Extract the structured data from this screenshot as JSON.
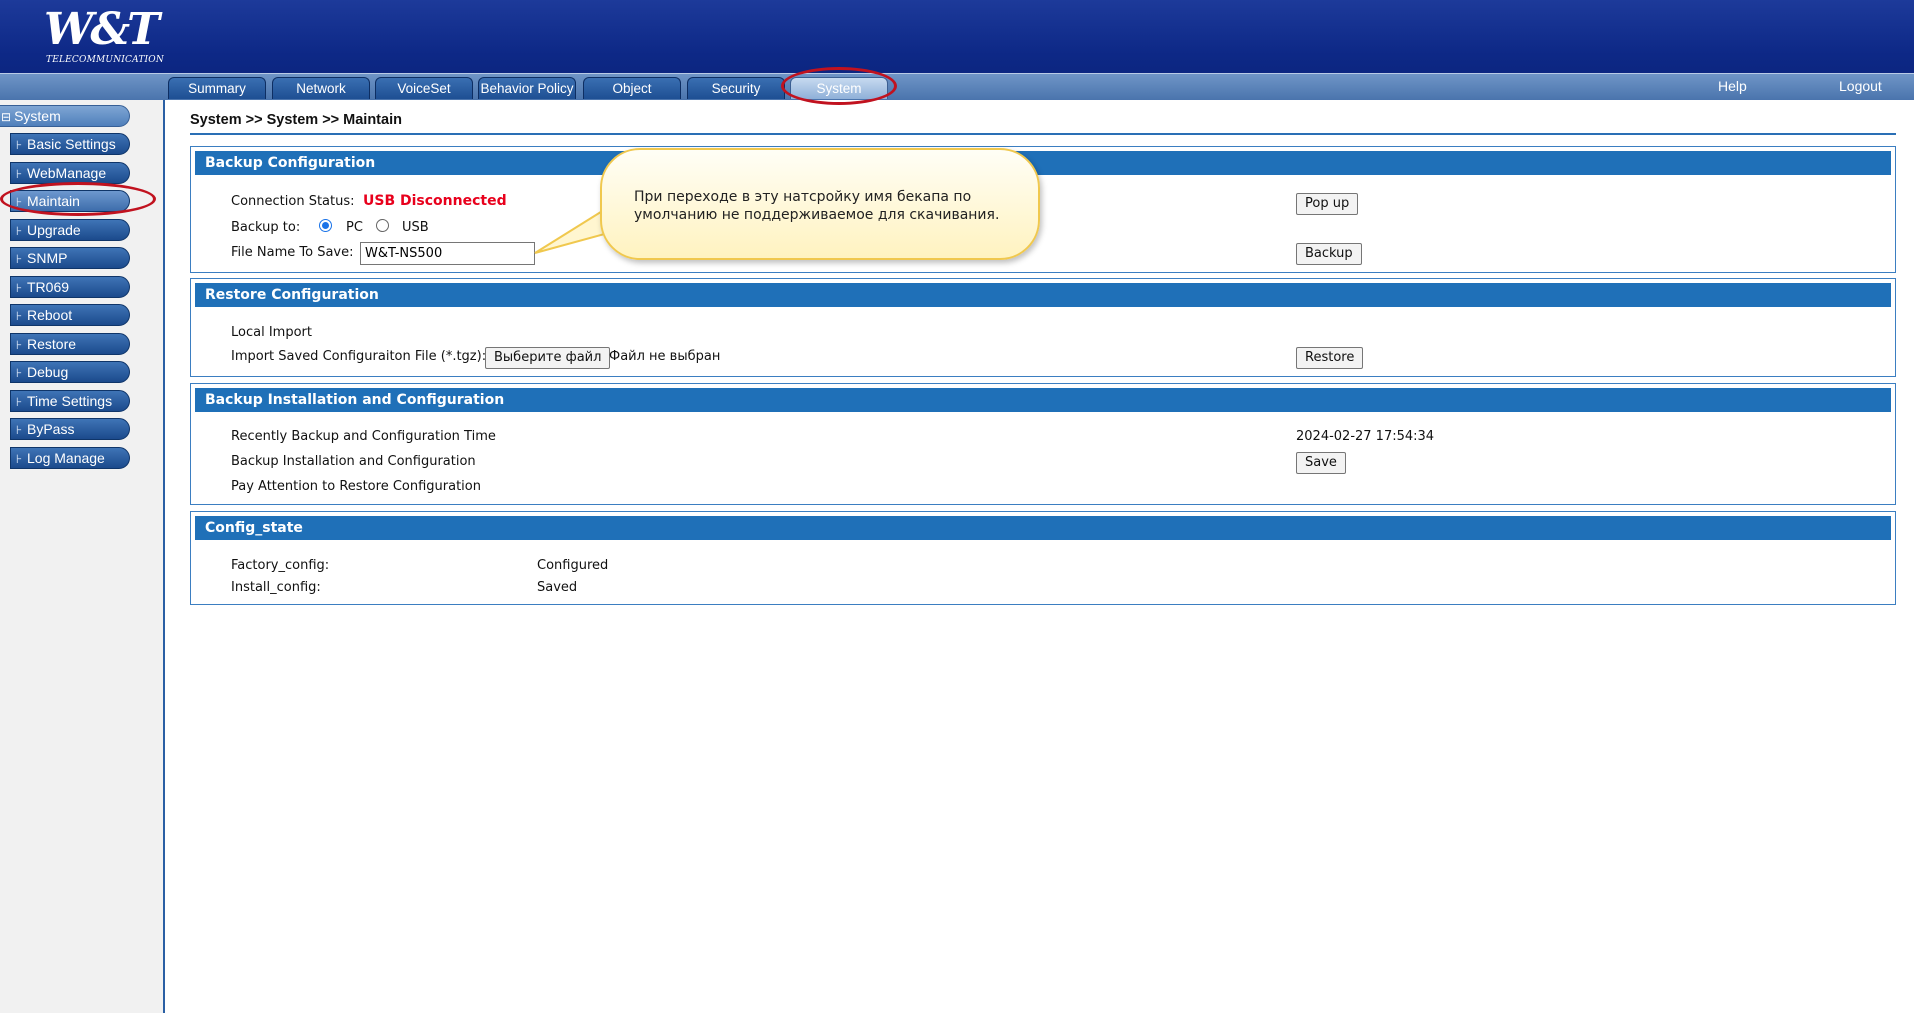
{
  "brand": {
    "logo_text": "W&T",
    "logo_sub": "TELECOMMUNICATION"
  },
  "nav": {
    "tabs": [
      "Summary",
      "Network",
      "VoiceSet",
      "Behavior Policy",
      "Object",
      "Security",
      "System"
    ],
    "active_tab": "System",
    "help": "Help",
    "logout": "Logout"
  },
  "sidebar": {
    "root": "System",
    "items": [
      "Basic Settings",
      "WebManage",
      "Maintain",
      "Upgrade",
      "SNMP",
      "TR069",
      "Reboot",
      "Restore",
      "Debug",
      "Time Settings",
      "ByPass",
      "Log Manage"
    ],
    "active_item": "Maintain"
  },
  "breadcrumb": "System >> System >>  Maintain",
  "backup": {
    "title": "Backup Configuration",
    "status_label": "Connection Status:",
    "status_value": "USB Disconnected",
    "backup_to_label": "Backup to:",
    "option_pc": "PC",
    "option_usb": "USB",
    "selected": "PC",
    "file_label": "File Name To Save:",
    "file_value": "W&T-NS500",
    "popup_btn": "Pop up",
    "backup_btn": "Backup"
  },
  "restore": {
    "title": "Restore Configuration",
    "local_import": "Local Import",
    "import_label": "Import Saved Configuraiton File (*.tgz):",
    "choose_btn": "Выберите файл",
    "no_file": "Файл не выбран",
    "restore_btn": "Restore"
  },
  "install": {
    "title": "Backup Installation and Configuration",
    "recent_label": "Recently Backup and Configuration Time",
    "recent_value": "2024-02-27 17:54:34",
    "install_label": "Backup Installation and Configuration",
    "save_btn": "Save",
    "attention_label": "Pay Attention to Restore Configuration"
  },
  "config_state": {
    "title": "Config_state",
    "rows": [
      {
        "label": "Factory_config:",
        "value": "Configured"
      },
      {
        "label": "Install_config:",
        "value": "Saved"
      }
    ]
  },
  "callout": {
    "text": "При переходе в эту натсройку имя бекапа по умолчанию не поддерживаемое для скачивания."
  },
  "colors": {
    "header": "#0d2886",
    "panel_header": "#1f70b8",
    "status_red": "#e8001c",
    "annotation_red": "#c1121f",
    "callout_border": "#f0c84e"
  }
}
